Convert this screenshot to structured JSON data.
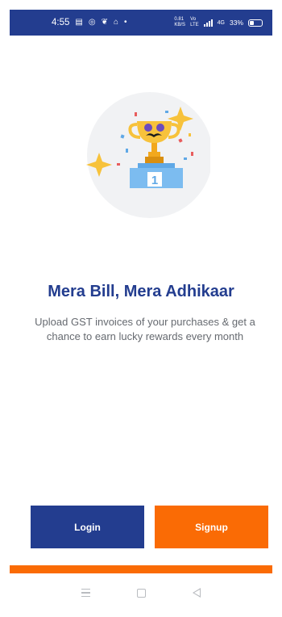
{
  "status_bar": {
    "time": "4:55",
    "icons_left": [
      "notification-icon",
      "whatsapp-icon",
      "snapchat-icon",
      "home-icon",
      "dot-icon"
    ],
    "speed_value": "0.81",
    "speed_unit": "KB/S",
    "volte_top": "Vo",
    "volte_bottom": "LTE",
    "network": "4G",
    "battery_text": "33%",
    "battery_level": 0.33
  },
  "onboarding": {
    "title": "Mera Bill, Mera Adhikaar",
    "subtitle": "Upload GST invoices of your purchases & get a chance to earn lucky rewards every month",
    "podium_number": "1"
  },
  "actions": {
    "login_label": "Login",
    "signup_label": "Signup"
  },
  "colors": {
    "primary": "#233d8f",
    "accent": "#fa6b05",
    "subtitle": "#666a70"
  }
}
